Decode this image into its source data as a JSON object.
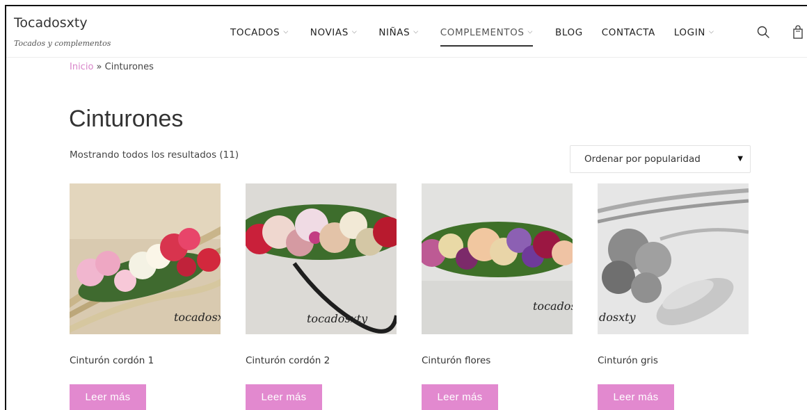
{
  "site": {
    "title": "Tocadosxty",
    "tagline": "Tocados y complementos"
  },
  "nav": {
    "items": [
      {
        "label": "TOCADOS",
        "has_dropdown": true
      },
      {
        "label": "NOVIAS",
        "has_dropdown": true
      },
      {
        "label": "NIÑAS",
        "has_dropdown": true
      },
      {
        "label": "COMPLEMENTOS",
        "has_dropdown": true,
        "active": true
      },
      {
        "label": "BLOG",
        "has_dropdown": false
      },
      {
        "label": "CONTACTA",
        "has_dropdown": false
      },
      {
        "label": "LOGIN",
        "has_dropdown": true
      }
    ],
    "chevron": "⌵",
    "search_icon": "search-icon",
    "cart_icon": "shopping-bag-icon"
  },
  "breadcrumb": {
    "home": "Inicio",
    "separator": " » ",
    "current": "Cinturones"
  },
  "page": {
    "title": "Cinturones",
    "results": "Mostrando todos los resultados (11)"
  },
  "sort": {
    "selected": "Ordenar por popularidad"
  },
  "products": [
    {
      "name": "Cinturón cordón 1",
      "button": "Leer más",
      "watermark": "tocadosxty"
    },
    {
      "name": "Cinturón cordón 2",
      "button": "Leer más",
      "watermark": "tocadosxty"
    },
    {
      "name": "Cinturón flores",
      "button": "Leer más",
      "watermark": "tocados"
    },
    {
      "name": "Cinturón gris",
      "button": "Leer más",
      "watermark": "dosxty"
    }
  ],
  "colors": {
    "accent_button": "#e289cf",
    "breadcrumb_link": "#d885c9",
    "text": "#333333"
  }
}
